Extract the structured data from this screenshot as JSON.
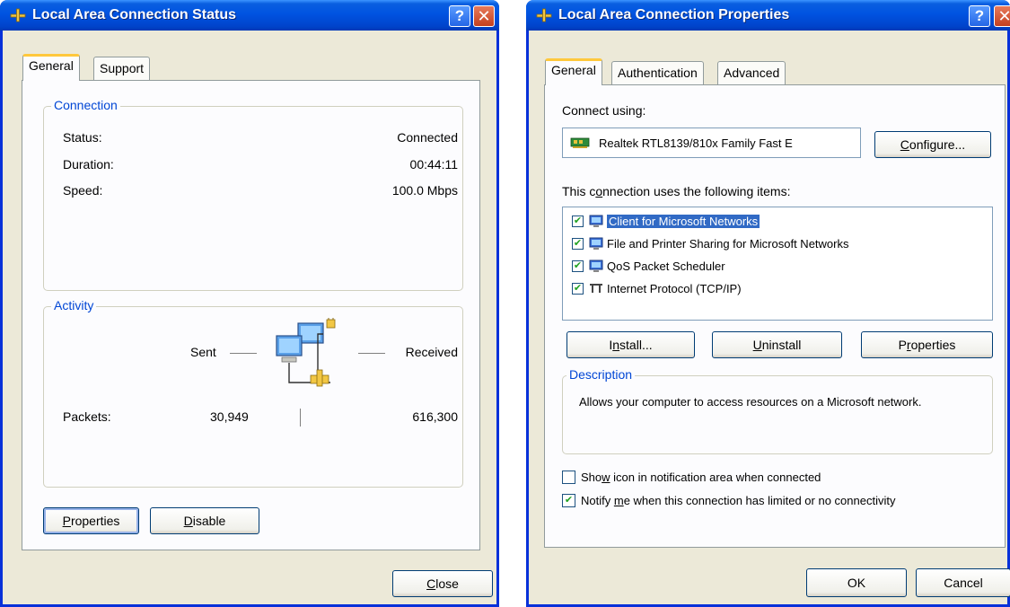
{
  "status_window": {
    "title": "Local Area Connection Status",
    "tabs": [
      {
        "label": "General"
      },
      {
        "label": "Support"
      }
    ],
    "connection": {
      "legend": "Connection",
      "rows": [
        {
          "label": "Status:",
          "value": "Connected"
        },
        {
          "label": "Duration:",
          "value": "00:44:11"
        },
        {
          "label": "Speed:",
          "value": "100.0 Mbps"
        }
      ]
    },
    "activity": {
      "legend": "Activity",
      "sent_label": "Sent",
      "received_label": "Received",
      "packets_label": "Packets:",
      "packets_sent": "30,949",
      "packets_received": "616,300"
    },
    "buttons": {
      "properties": {
        "accel": "P",
        "rest": "roperties"
      },
      "disable": {
        "accel": "D",
        "rest": "isable"
      },
      "close": {
        "accel": "C",
        "rest": "lose"
      }
    }
  },
  "properties_window": {
    "title": "Local Area Connection Properties",
    "tabs": [
      {
        "label": "General"
      },
      {
        "label": "Authentication"
      },
      {
        "label": "Advanced"
      }
    ],
    "connect_using_label": "Connect using:",
    "adapter_name": "Realtek RTL8139/810x Family Fast E",
    "configure_button": {
      "accel": "C",
      "rest": "onfigure..."
    },
    "items_label_pre": "This c",
    "items_label_accel": "o",
    "items_label_post": "nnection uses the following items:",
    "items": [
      {
        "label": "Client for Microsoft Networks",
        "checked": true,
        "selected": true,
        "icon": "network-client-icon"
      },
      {
        "label": "File and Printer Sharing for Microsoft Networks",
        "checked": true,
        "selected": false,
        "icon": "network-service-icon"
      },
      {
        "label": "QoS Packet Scheduler",
        "checked": true,
        "selected": false,
        "icon": "network-service-icon"
      },
      {
        "label": "Internet Protocol (TCP/IP)",
        "checked": true,
        "selected": false,
        "icon": "protocol-icon"
      }
    ],
    "buttons": {
      "install": {
        "pre": "I",
        "accel": "n",
        "post": "stall..."
      },
      "uninstall": {
        "accel": "U",
        "rest": "ninstall"
      },
      "properties": {
        "pre": "P",
        "accel": "r",
        "post": "operties"
      },
      "ok": "OK",
      "cancel": "Cancel"
    },
    "description": {
      "legend": "Description",
      "text": "Allows your computer to access resources on a Microsoft network."
    },
    "options": [
      {
        "label_pre": "Sho",
        "label_accel": "w",
        "label_post": " icon in notification area when connected",
        "checked": false
      },
      {
        "label_pre": "Notify ",
        "label_accel": "m",
        "label_post": "e when this connection has limited or no connectivity",
        "checked": true
      }
    ]
  }
}
